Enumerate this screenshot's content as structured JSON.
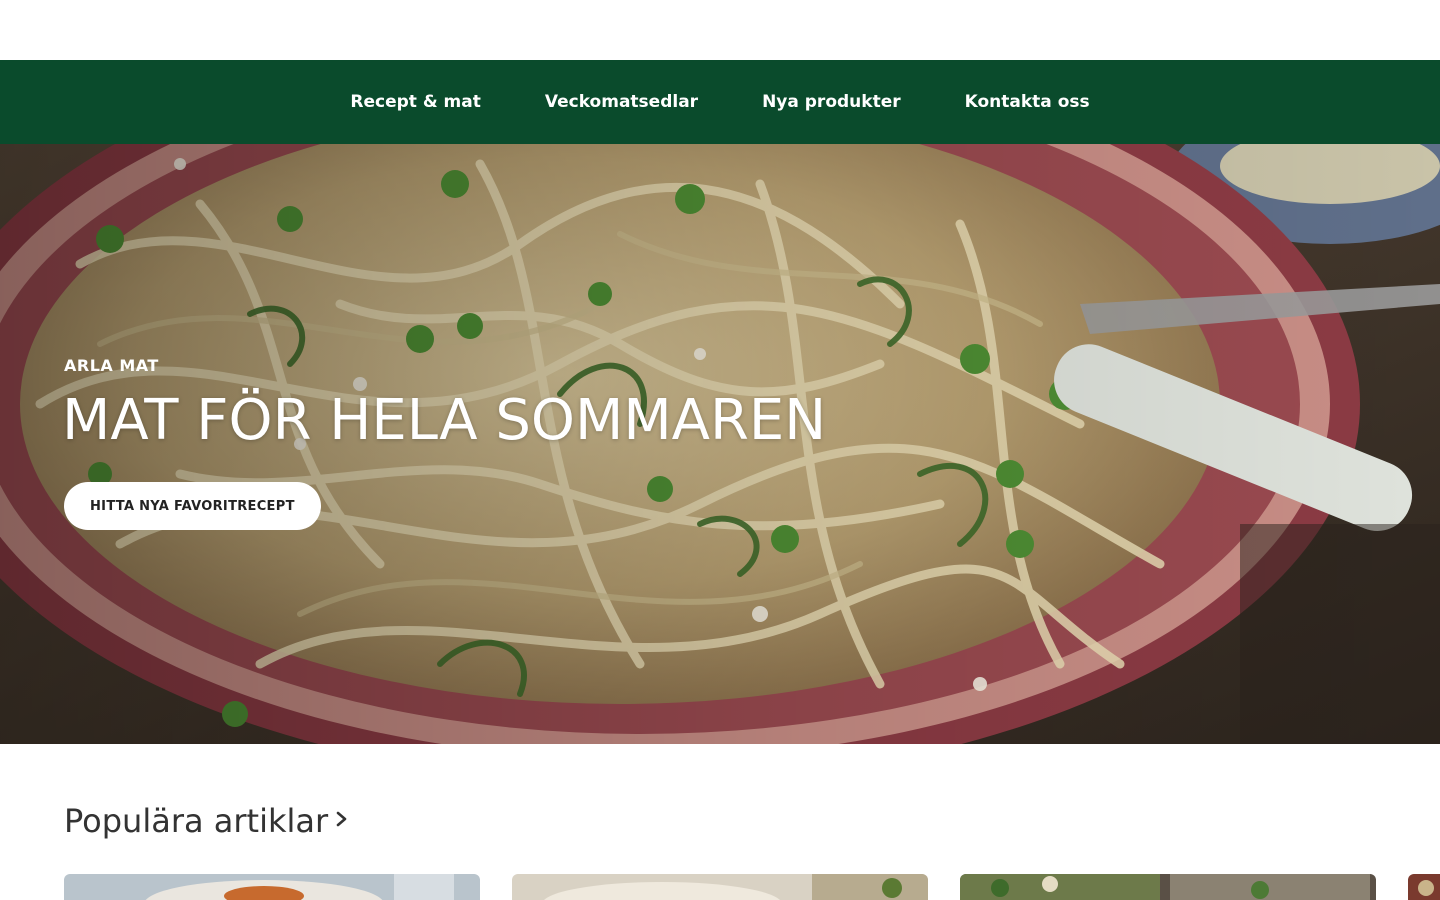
{
  "nav": {
    "items": [
      {
        "label": "Recept & mat"
      },
      {
        "label": "Veckomatsedlar"
      },
      {
        "label": "Nya produkter"
      },
      {
        "label": "Kontakta oss"
      }
    ]
  },
  "hero": {
    "eyebrow": "ARLA MAT",
    "headline": "MAT FÖR HELA SOMMAREN",
    "cta_label": "HITTA NYA FAVORITRECEPT"
  },
  "popular": {
    "heading": "Populära artiklar"
  },
  "colors": {
    "nav_bg": "#0a4b2c",
    "cta_bg": "#ffffff",
    "heading_text": "#333333"
  },
  "icons": {
    "section_arrow": "chevron-right-icon"
  }
}
